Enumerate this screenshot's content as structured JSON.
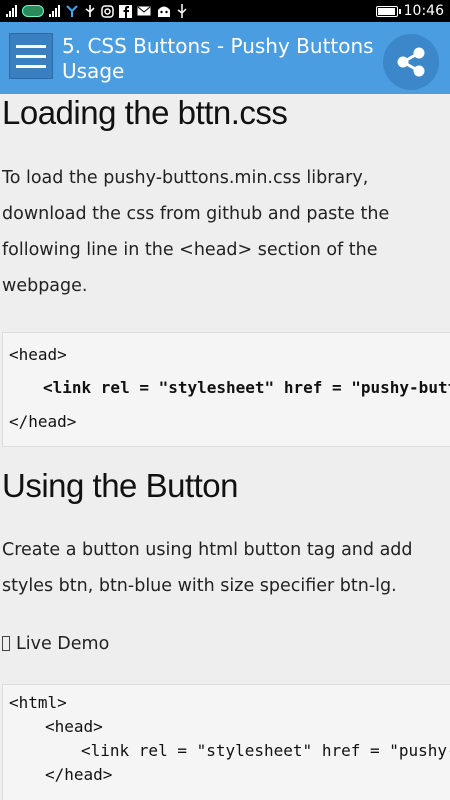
{
  "status_bar": {
    "time": "10:46",
    "icons": [
      "signal-icon",
      "carrier-icon",
      "signal-icon",
      "data-icon",
      "usb-icon",
      "instagram-icon",
      "facebook-icon",
      "mail-icon",
      "android-icon",
      "usb-debug-icon",
      "battery-icon"
    ]
  },
  "app_bar": {
    "title": "5. CSS Buttons - Pushy Buttons Usage",
    "menu_icon": "hamburger-menu-icon",
    "share_icon": "share-icon"
  },
  "sections": [
    {
      "heading": "Loading the bttn.css",
      "paragraph": "To load the pushy-buttons.min.css library, download the css from github and paste the following line in the <head> section of the webpage.",
      "code": [
        "<head>",
        "<link rel = \"stylesheet\" href = \"pushy-buttons.min.css\">",
        "</head>"
      ]
    },
    {
      "heading": "Using the Button",
      "paragraph": "Create a button using html button tag and add styles btn, btn-blue with size specifier btn-lg.",
      "demo_label": "Live Demo",
      "code": [
        "<html>",
        "<head>",
        "<link rel = \"stylesheet\" href = \"pushy-buttons.min.css\">",
        "</head>"
      ]
    }
  ]
}
